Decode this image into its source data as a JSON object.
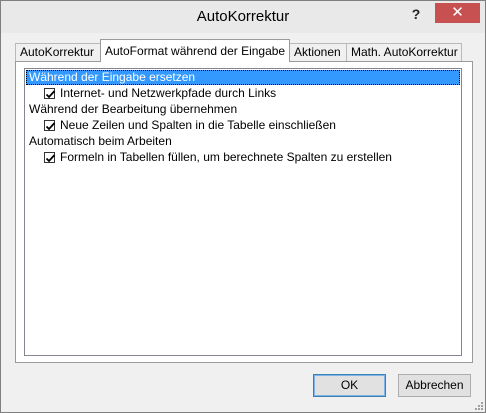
{
  "window": {
    "title": "AutoKorrektur",
    "help_label": "?",
    "close_label": "✕"
  },
  "tabs": [
    {
      "label": "AutoKorrektur"
    },
    {
      "label": "AutoFormat während der Eingabe",
      "active": true
    },
    {
      "label": "Aktionen"
    },
    {
      "label": "Math. AutoKorrektur"
    }
  ],
  "list": {
    "groups": [
      {
        "label": "Während der Eingabe ersetzen",
        "selected": true
      },
      {
        "label": "Während der Bearbeitung übernehmen"
      },
      {
        "label": "Automatisch beim Arbeiten"
      }
    ],
    "items": [
      {
        "label": "Internet- und Netzwerkpfade durch Links",
        "checked": true
      },
      {
        "label": "Neue Zeilen und Spalten in die Tabelle einschließen",
        "checked": true
      },
      {
        "label": "Formeln in Tabellen füllen, um berechnete Spalten zu erstellen",
        "checked": true
      }
    ]
  },
  "buttons": {
    "ok_label": "OK",
    "cancel_label": "Abbrechen"
  },
  "colors": {
    "selection": "#3399ff",
    "close_button": "#c75050"
  },
  "icons": {
    "checkbox": "checkmark-icon",
    "resize": "resize-grip-icon"
  }
}
